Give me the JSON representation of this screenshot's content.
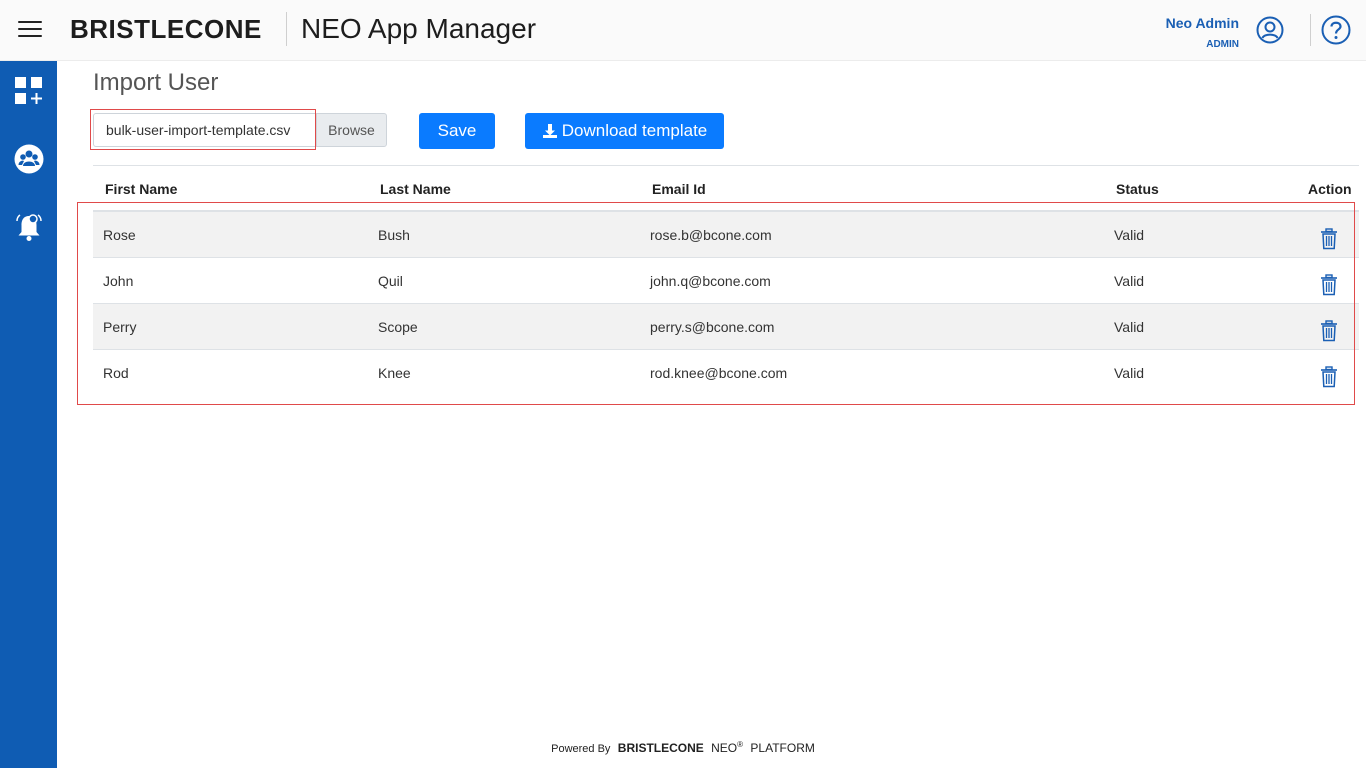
{
  "header": {
    "logo_text": "BRISTLECONE",
    "app_title": "NEO App Manager",
    "user_name": "Neo Admin",
    "user_role": "ADMIN"
  },
  "sidebar": {
    "items": [
      {
        "icon": "dashboard-add-icon"
      },
      {
        "icon": "users-group-icon"
      },
      {
        "icon": "notification-bell-icon"
      }
    ]
  },
  "page": {
    "title": "Import User",
    "file_name": "bulk-user-import-template.csv",
    "browse_label": "Browse",
    "save_label": "Save",
    "download_label": "Download template"
  },
  "table": {
    "columns": [
      "First Name",
      "Last Name",
      "Email Id",
      "Status",
      "Action"
    ],
    "rows": [
      {
        "first": "Rose",
        "last": "Bush",
        "email": "rose.b@bcone.com",
        "status": "Valid"
      },
      {
        "first": "John",
        "last": "Quil",
        "email": "john.q@bcone.com",
        "status": "Valid"
      },
      {
        "first": "Perry",
        "last": "Scope",
        "email": "perry.s@bcone.com",
        "status": "Valid"
      },
      {
        "first": "Rod",
        "last": "Knee",
        "email": "rod.knee@bcone.com",
        "status": "Valid"
      }
    ]
  },
  "footer": {
    "powered_by": "Powered By",
    "brand": "BRISTLECONE",
    "neo": "NEO",
    "reg": "®",
    "platform": "PLATFORM"
  },
  "colors": {
    "sidebar": "#0f5cb3",
    "primary_button": "#0a7bff",
    "link_text": "#1a5fb4",
    "highlight": "#e04a4a"
  }
}
